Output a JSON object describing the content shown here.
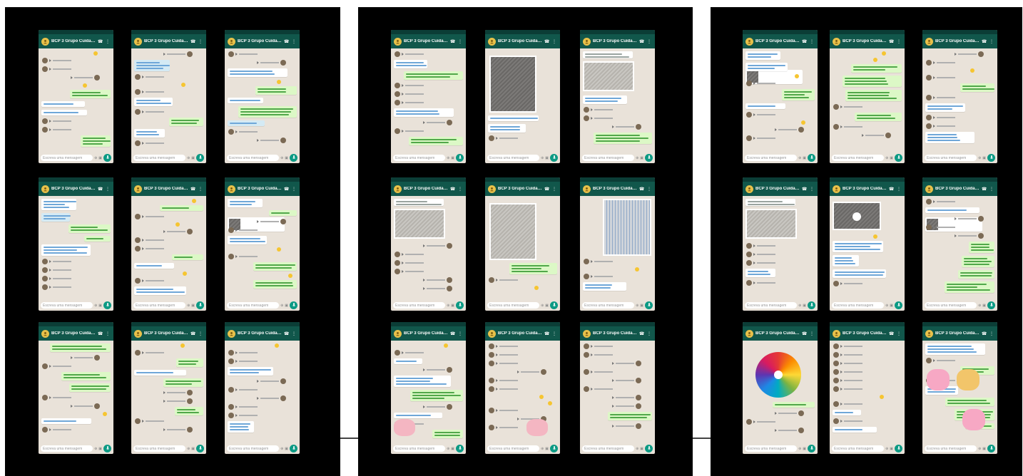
{
  "chat_title": "BCP 3 Grupo Cuidadoras ...",
  "input_placeholder": "Escreva uma mensagem",
  "icons": {
    "avatar": "group-avatar-icon",
    "mic": "mic-icon",
    "emoji": "emoji-icon",
    "attach": "paperclip-icon",
    "camera": "camera-icon",
    "call": "phone-icon",
    "menu": "menu-dots-icon"
  },
  "colors": {
    "header": "#11574b",
    "chat_bg": "#e9e2d9",
    "outgoing": "#dcf8c6",
    "incoming": "#ffffff",
    "accent": "#0c9a84"
  }
}
